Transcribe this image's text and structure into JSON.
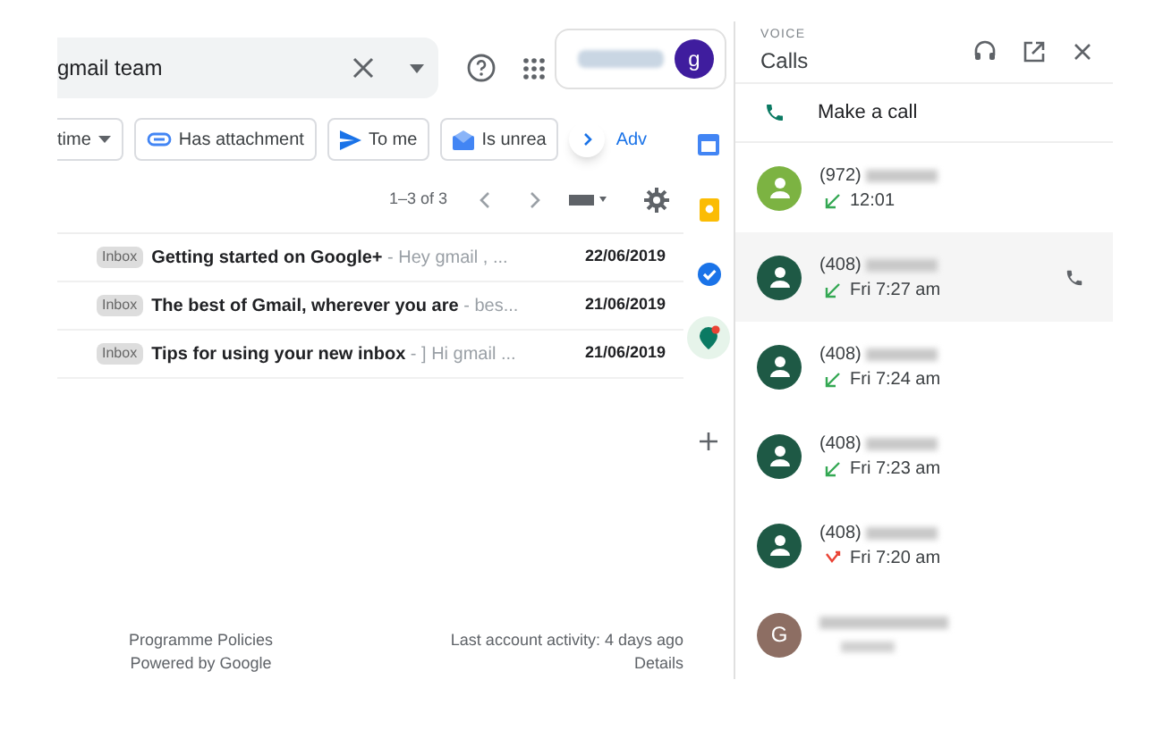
{
  "search": {
    "value": "gmail team"
  },
  "account": {
    "avatar_letter": "g"
  },
  "chips": [
    {
      "label": "time",
      "kind": "dropdown"
    },
    {
      "label": "Has attachment",
      "kind": "attachment"
    },
    {
      "label": "To me",
      "kind": "send"
    },
    {
      "label": "Is unrea",
      "kind": "unread"
    }
  ],
  "more_filters": "Adv",
  "pagination": "1–3 of 3",
  "emails": [
    {
      "tag": "Inbox",
      "subject": "Getting started on Google+",
      "snippet": " - Hey gmail , ...",
      "date": "22/06/2019"
    },
    {
      "tag": "Inbox",
      "subject": "The best of Gmail, wherever you are",
      "snippet": " - bes...",
      "date": "21/06/2019"
    },
    {
      "tag": "Inbox",
      "subject": "Tips for using your new inbox",
      "snippet": " - ] Hi gmail ...",
      "date": "21/06/2019"
    }
  ],
  "footer": {
    "left": [
      "Programme Policies",
      "Powered by Google"
    ],
    "right": [
      "Last account activity: 4 days ago",
      "Details"
    ]
  },
  "side_apps": [
    {
      "kind": "calendar",
      "selected": false
    },
    {
      "kind": "keep",
      "selected": false
    },
    {
      "kind": "tasks",
      "selected": false
    },
    {
      "kind": "voice",
      "selected": true
    }
  ],
  "voice": {
    "overline": "VOICE",
    "title": "Calls",
    "make_call": "Make a call",
    "calls": [
      {
        "number": "(972)",
        "time": "12:01",
        "kind": "incoming",
        "color": "#7cb342",
        "hovered": false
      },
      {
        "number": "(408)",
        "time": "Fri 7:27 am",
        "kind": "incoming",
        "color": "#1e5945",
        "hovered": true
      },
      {
        "number": "(408)",
        "time": "Fri 7:24 am",
        "kind": "incoming",
        "color": "#1e5945",
        "hovered": false
      },
      {
        "number": "(408)",
        "time": "Fri 7:23 am",
        "kind": "incoming",
        "color": "#1e5945",
        "hovered": false
      },
      {
        "number": "(408)",
        "time": "Fri 7:20 am",
        "kind": "missed",
        "color": "#1e5945",
        "hovered": false
      },
      {
        "letter": "G",
        "kind": "contact",
        "color": "#8d6e63",
        "hovered": false
      }
    ]
  }
}
